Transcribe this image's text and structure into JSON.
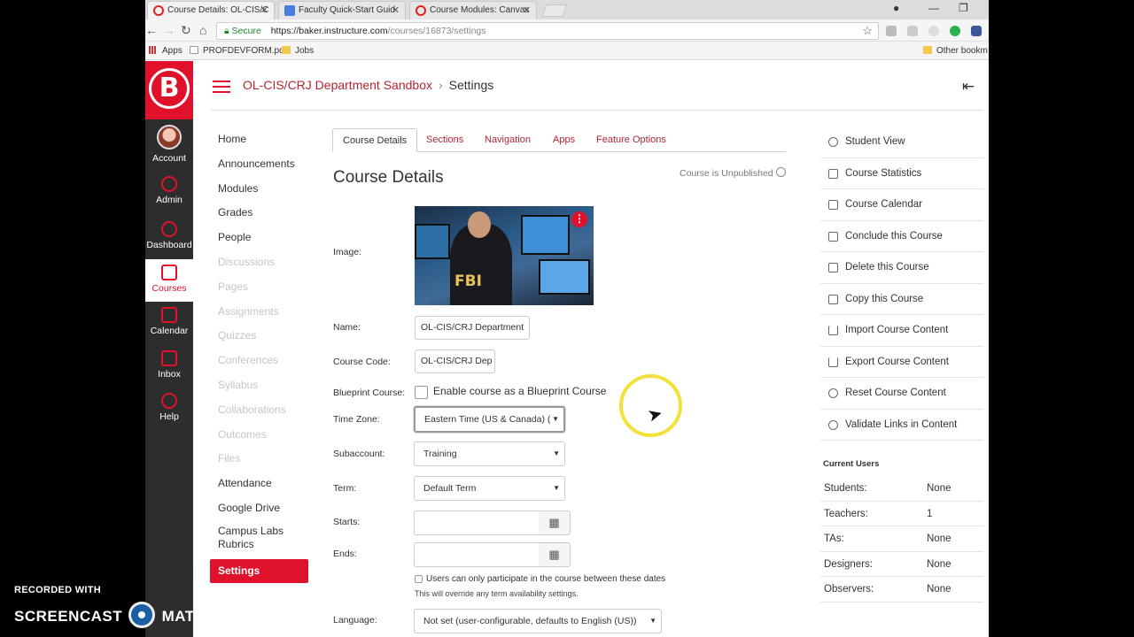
{
  "browser": {
    "tabs": [
      {
        "title": "Course Details: OL-CIS/C"
      },
      {
        "title": "Faculty Quick-Start Guid"
      },
      {
        "title": "Course Modules: Canvas"
      }
    ],
    "secure_label": "Secure",
    "url_host": "https://baker.instructure.com",
    "url_path": "/courses/16873/settings",
    "bookmarks": [
      "Apps",
      "PROFDEVFORM.pdf",
      "Jobs",
      "Other bookm"
    ]
  },
  "global_nav": {
    "logo_letter": "B",
    "items": [
      {
        "label": "Account"
      },
      {
        "label": "Admin"
      },
      {
        "label": "Dashboard"
      },
      {
        "label": "Courses"
      },
      {
        "label": "Calendar"
      },
      {
        "label": "Inbox"
      },
      {
        "label": "Help"
      }
    ]
  },
  "header": {
    "course_link": "OL-CIS/CRJ Department Sandbox",
    "separator": "›",
    "current": "Settings"
  },
  "course_nav": {
    "items": [
      {
        "label": "Home",
        "hidden": false
      },
      {
        "label": "Announcements",
        "hidden": false
      },
      {
        "label": "Modules",
        "hidden": false
      },
      {
        "label": "Grades",
        "hidden": false
      },
      {
        "label": "People",
        "hidden": false
      },
      {
        "label": "Discussions",
        "hidden": true
      },
      {
        "label": "Pages",
        "hidden": true
      },
      {
        "label": "Assignments",
        "hidden": true
      },
      {
        "label": "Quizzes",
        "hidden": true
      },
      {
        "label": "Conferences",
        "hidden": true
      },
      {
        "label": "Syllabus",
        "hidden": true
      },
      {
        "label": "Collaborations",
        "hidden": true
      },
      {
        "label": "Outcomes",
        "hidden": true
      },
      {
        "label": "Files",
        "hidden": true
      },
      {
        "label": "Attendance",
        "hidden": false
      },
      {
        "label": "Google Drive",
        "hidden": false
      },
      {
        "label": "Campus Labs Rubrics",
        "hidden": false
      }
    ],
    "active": "Settings"
  },
  "settings_tabs": [
    "Course Details",
    "Sections",
    "Navigation",
    "Apps",
    "Feature Options"
  ],
  "details": {
    "heading": "Course Details",
    "status": "Course is Unpublished",
    "labels": {
      "image": "Image:",
      "name": "Name:",
      "code": "Course Code:",
      "blueprint": "Blueprint Course:",
      "timezone": "Time Zone:",
      "subaccount": "Subaccount:",
      "term": "Term:",
      "starts": "Starts:",
      "ends": "Ends:",
      "language": "Language:"
    },
    "name_value": "OL-CIS/CRJ Department",
    "code_value": "OL-CIS/CRJ Dep",
    "blueprint_checkbox_label": "Enable course as a Blueprint Course",
    "timezone_value": "Eastern Time (US & Canada) (",
    "subaccount_value": "Training",
    "term_value": "Default Term",
    "starts_value": "",
    "ends_value": "",
    "date_restriction_label": "Users can only participate in the course between these dates",
    "date_restriction_note": "This will override any term availability settings.",
    "language_value": "Not set (user-configurable, defaults to English (US))",
    "image_text": "FBI"
  },
  "sidebar": {
    "actions": [
      "Student View",
      "Course Statistics",
      "Course Calendar",
      "Conclude this Course",
      "Delete this Course",
      "Copy this Course",
      "Import Course Content",
      "Export Course Content",
      "Reset Course Content",
      "Validate Links in Content"
    ],
    "current_users_heading": "Current Users",
    "current_users": [
      {
        "role": "Students:",
        "count": "None"
      },
      {
        "role": "Teachers:",
        "count": "1"
      },
      {
        "role": "TAs:",
        "count": "None"
      },
      {
        "role": "Designers:",
        "count": "None"
      },
      {
        "role": "Observers:",
        "count": "None"
      }
    ]
  },
  "watermark": {
    "line1": "RECORDED WITH",
    "part_a": "SCREENCAST",
    "part_b": "MATIC"
  },
  "colors": {
    "brand_red": "#e0112b",
    "link_red": "#b32535",
    "nav_dark": "#2d2d2d"
  }
}
